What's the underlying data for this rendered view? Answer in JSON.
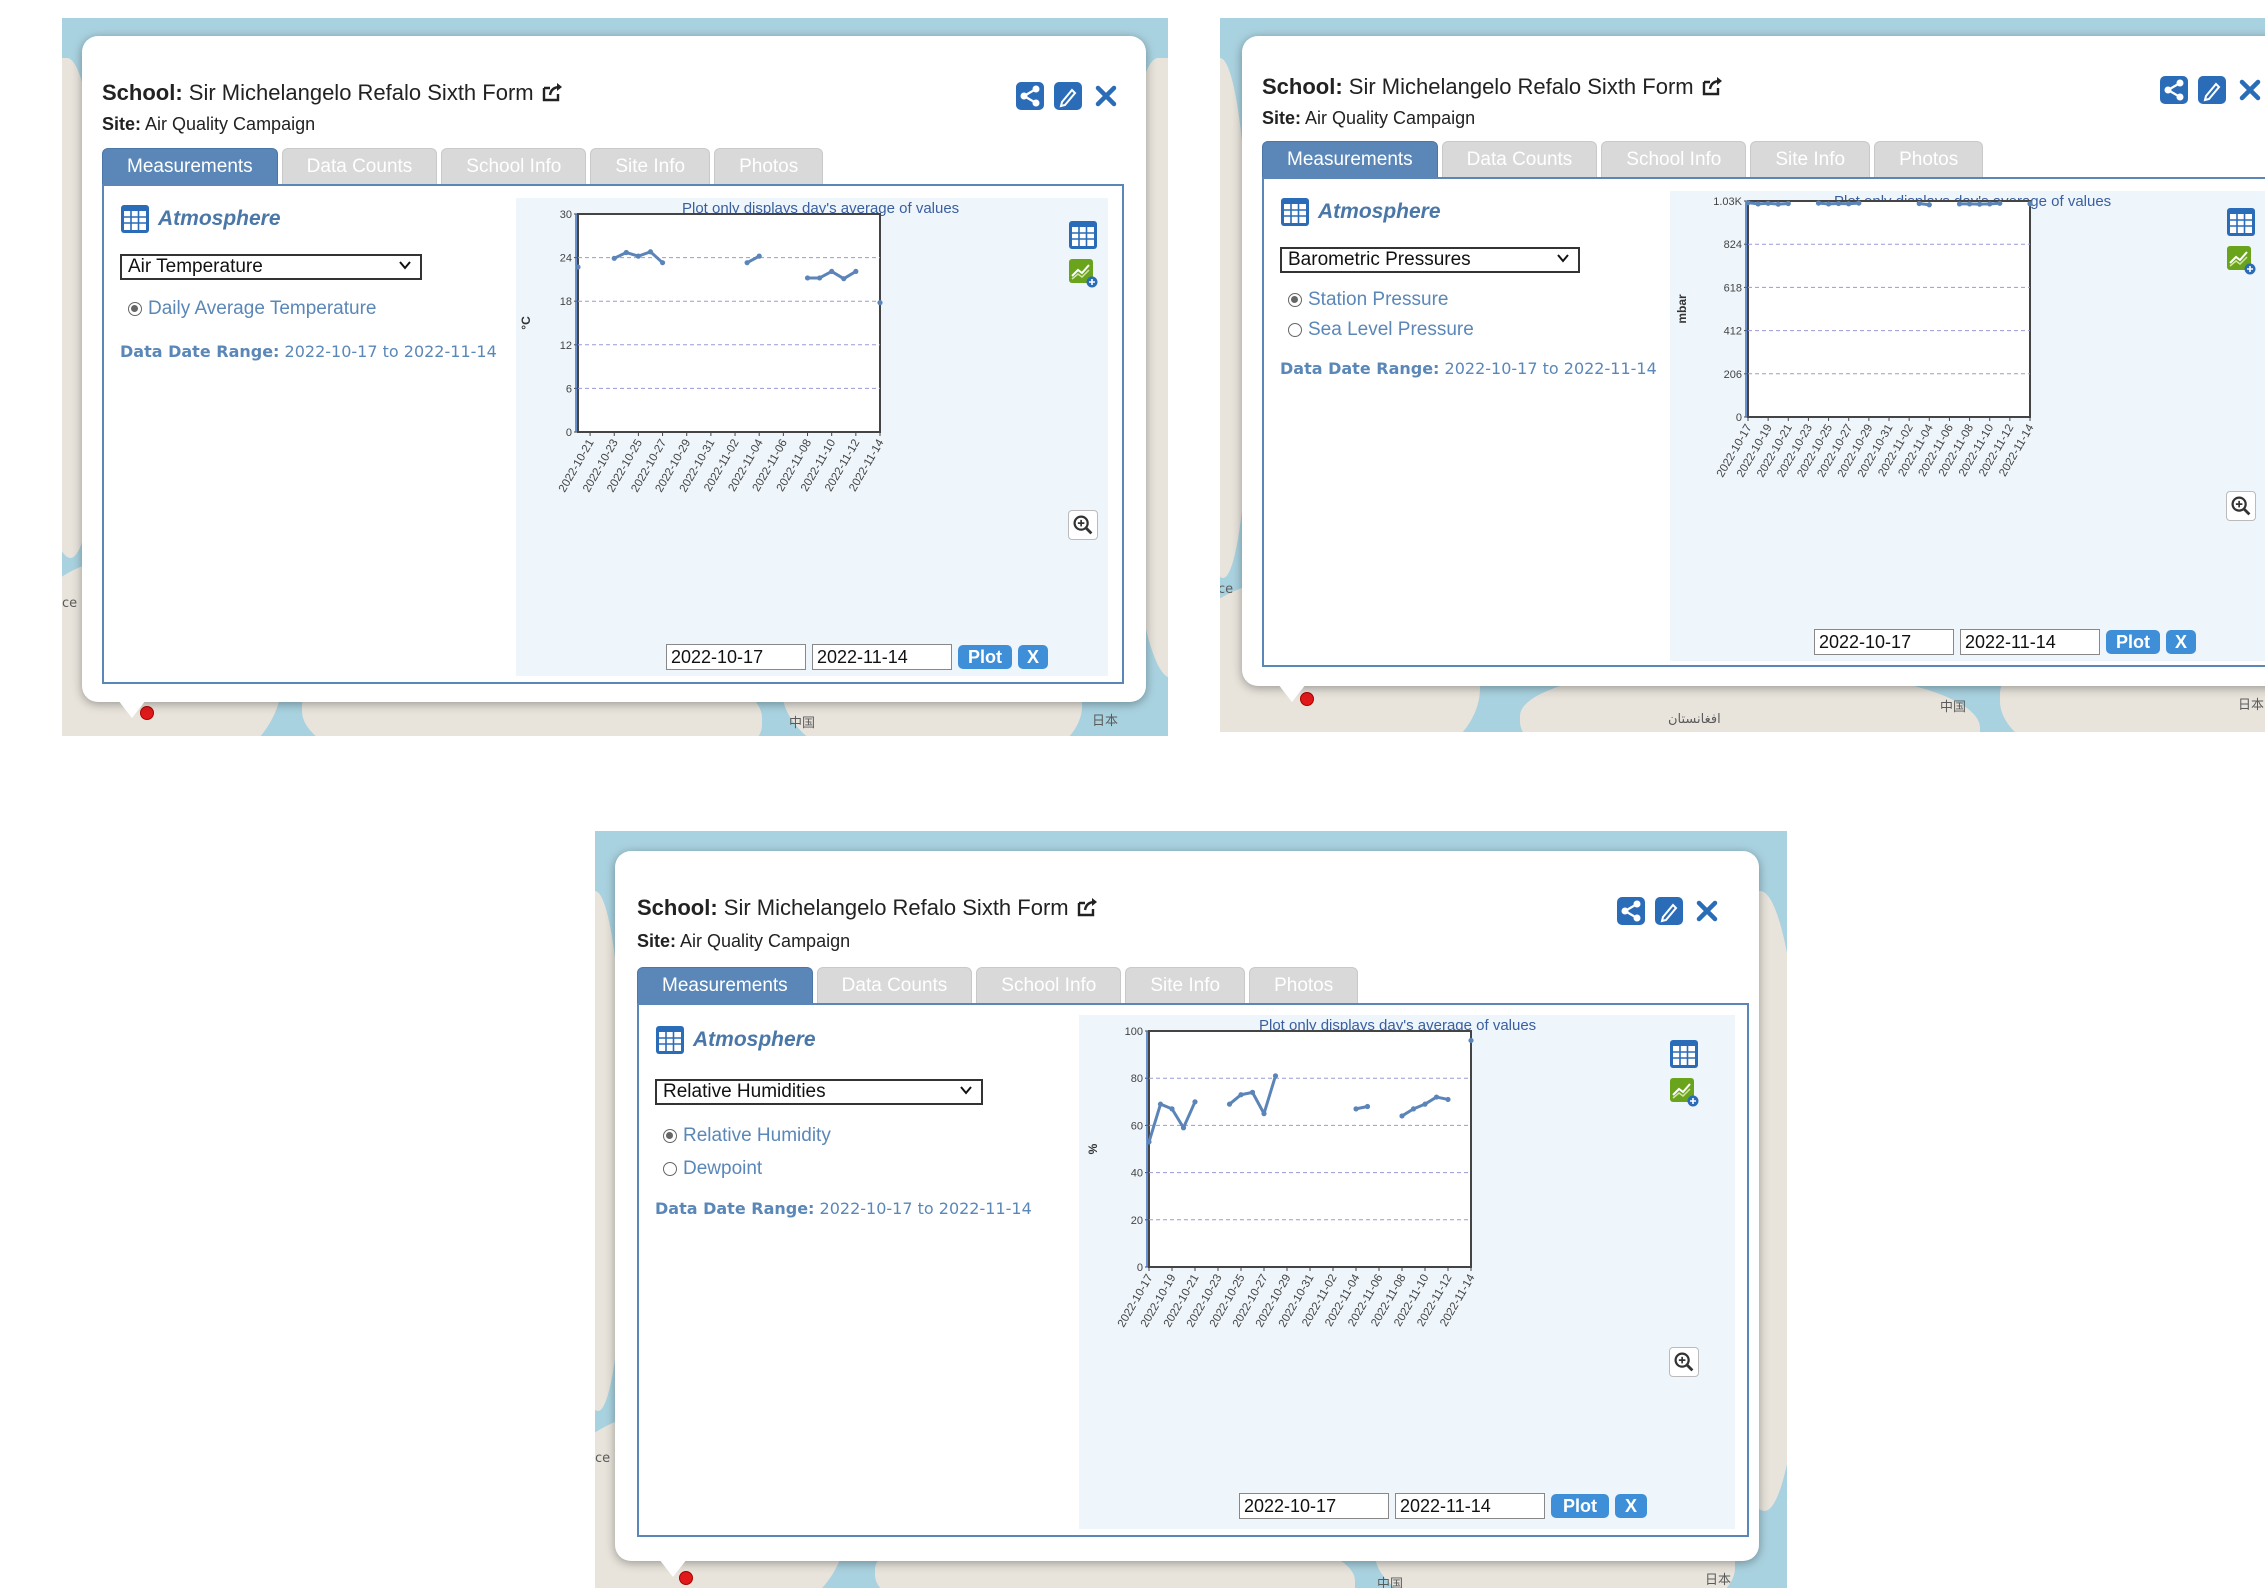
{
  "popups": [
    {
      "school_label": "School:",
      "school_name": "Sir Michelangelo Refalo Sixth Form",
      "site_label": "Site:",
      "site_name": "Air Quality Campaign",
      "tabs": [
        "Measurements",
        "Data Counts",
        "School Info",
        "Site Info",
        "Photos"
      ],
      "category": "Atmosphere",
      "select_value": "Air Temperature",
      "radios": [
        {
          "label": "Daily Average Temperature",
          "checked": true
        }
      ],
      "range_label": "Data Date Range:",
      "range_value": "2022-10-17 to 2022-11-14",
      "plot_note": "Plot only displays day's average of values",
      "date_from": "2022-10-17",
      "date_to": "2022-11-14",
      "plot_button": "Plot",
      "clear_button": "X",
      "map_labels": [
        "中国",
        "日本",
        "ce"
      ]
    },
    {
      "school_label": "School:",
      "school_name": "Sir Michelangelo Refalo Sixth Form",
      "site_label": "Site:",
      "site_name": "Air Quality Campaign",
      "tabs": [
        "Measurements",
        "Data Counts",
        "School Info",
        "Site Info",
        "Photos"
      ],
      "category": "Atmosphere",
      "select_value": "Barometric Pressures",
      "radios": [
        {
          "label": "Station Pressure",
          "checked": true
        },
        {
          "label": "Sea Level Pressure",
          "checked": false
        }
      ],
      "range_label": "Data Date Range:",
      "range_value": "2022-10-17 to 2022-11-14",
      "plot_note": "Plot only displays day's average of values",
      "date_from": "2022-10-17",
      "date_to": "2022-11-14",
      "plot_button": "Plot",
      "clear_button": "X",
      "map_labels": [
        "中国",
        "日本",
        "افغانستان",
        "ce"
      ]
    },
    {
      "school_label": "School:",
      "school_name": "Sir Michelangelo Refalo Sixth Form",
      "site_label": "Site:",
      "site_name": "Air Quality Campaign",
      "tabs": [
        "Measurements",
        "Data Counts",
        "School Info",
        "Site Info",
        "Photos"
      ],
      "category": "Atmosphere",
      "select_value": "Relative Humidities",
      "radios": [
        {
          "label": "Relative Humidity",
          "checked": true
        },
        {
          "label": "Dewpoint",
          "checked": false
        }
      ],
      "range_label": "Data Date Range:",
      "range_value": "2022-10-17 to 2022-11-14",
      "plot_note": "Plot only displays day's average of values",
      "date_from": "2022-10-17",
      "date_to": "2022-11-14",
      "plot_button": "Plot",
      "clear_button": "X",
      "map_labels": [
        "中国",
        "日本",
        "ce"
      ]
    }
  ],
  "colors": {
    "accent": "#5a87b8",
    "series": "#5b84b8",
    "button": "#3f8fd8",
    "tab_inactive": "#d9d9d9",
    "pin": "#e01a1a",
    "map_water": "#a9d2e0",
    "map_land": "#e8e4dc",
    "chart_bg": "#eef5fb"
  },
  "icons": [
    "external-link-icon",
    "share-icon",
    "edit-icon",
    "close-icon",
    "table-icon",
    "chart-add-icon",
    "zoom-in-icon",
    "chevron-down-icon"
  ],
  "chart_data": [
    {
      "type": "line",
      "ylabel": "°C",
      "ylim": [
        0,
        30
      ],
      "yticks": [
        "0",
        "6",
        "12",
        "18",
        "24",
        "30"
      ],
      "xticks": [
        "2022-10-21",
        "2022-10-23",
        "2022-10-25",
        "2022-10-27",
        "2022-10-29",
        "2022-10-31",
        "2022-11-02",
        "2022-11-04",
        "2022-11-06",
        "2022-11-08",
        "2022-11-10",
        "2022-11-12",
        "2022-11-14"
      ],
      "grid": true,
      "x": [
        "2022-10-20",
        "2022-10-23",
        "2022-10-24",
        "2022-10-25",
        "2022-10-26",
        "2022-10-27",
        "2022-11-03",
        "2022-11-04",
        "2022-11-08",
        "2022-11-09",
        "2022-11-10",
        "2022-11-11",
        "2022-11-12",
        "2022-11-14"
      ],
      "values": [
        22.7,
        23.9,
        24.7,
        24.2,
        24.8,
        23.3,
        23.3,
        24.2,
        21.2,
        21.2,
        22.1,
        21.1,
        22.1,
        17.8
      ],
      "gaps_after": [
        "2022-10-20",
        "2022-10-27",
        "2022-11-04",
        "2022-11-12"
      ]
    },
    {
      "type": "line",
      "ylabel": "mbar",
      "ylim": [
        0,
        1030
      ],
      "yticks": [
        "0",
        "206",
        "412",
        "618",
        "824",
        "1.03K"
      ],
      "xticks": [
        "2022-10-17",
        "2022-10-19",
        "2022-10-21",
        "2022-10-23",
        "2022-10-25",
        "2022-10-27",
        "2022-10-29",
        "2022-10-31",
        "2022-11-02",
        "2022-11-04",
        "2022-11-06",
        "2022-11-08",
        "2022-11-10",
        "2022-11-12",
        "2022-11-14"
      ],
      "grid": true,
      "x": [
        "2022-10-17",
        "2022-10-18",
        "2022-10-19",
        "2022-10-20",
        "2022-10-21",
        "2022-10-24",
        "2022-10-25",
        "2022-10-26",
        "2022-10-27",
        "2022-10-28",
        "2022-11-03",
        "2022-11-04",
        "2022-11-07",
        "2022-11-08",
        "2022-11-09",
        "2022-11-10",
        "2022-11-11",
        "2022-11-14"
      ],
      "values": [
        1022,
        1016,
        1019,
        1015,
        1018,
        1020,
        1016,
        1018,
        1017,
        1020,
        1018,
        1012,
        1016,
        1016,
        1015,
        1016,
        1019,
        1017
      ],
      "gaps_after": [
        "2022-10-21",
        "2022-10-28",
        "2022-11-04",
        "2022-11-11"
      ]
    },
    {
      "type": "line",
      "ylabel": "%",
      "ylim": [
        0,
        100
      ],
      "yticks": [
        "0",
        "20",
        "40",
        "60",
        "80",
        "100"
      ],
      "xticks": [
        "2022-10-17",
        "2022-10-19",
        "2022-10-21",
        "2022-10-23",
        "2022-10-25",
        "2022-10-27",
        "2022-10-29",
        "2022-10-31",
        "2022-11-02",
        "2022-11-04",
        "2022-11-06",
        "2022-11-08",
        "2022-11-10",
        "2022-11-12",
        "2022-11-14"
      ],
      "grid": true,
      "x": [
        "2022-10-17",
        "2022-10-18",
        "2022-10-19",
        "2022-10-20",
        "2022-10-21",
        "2022-10-24",
        "2022-10-25",
        "2022-10-26",
        "2022-10-27",
        "2022-10-28",
        "2022-11-04",
        "2022-11-05",
        "2022-11-08",
        "2022-11-09",
        "2022-11-10",
        "2022-11-11",
        "2022-11-12",
        "2022-11-14"
      ],
      "values": [
        53,
        69,
        67,
        59,
        70,
        69,
        73,
        74,
        65,
        81,
        67,
        68,
        64,
        67,
        69,
        72,
        71,
        96
      ],
      "gaps_after": [
        "2022-10-21",
        "2022-10-28",
        "2022-11-05",
        "2022-11-12"
      ]
    }
  ]
}
